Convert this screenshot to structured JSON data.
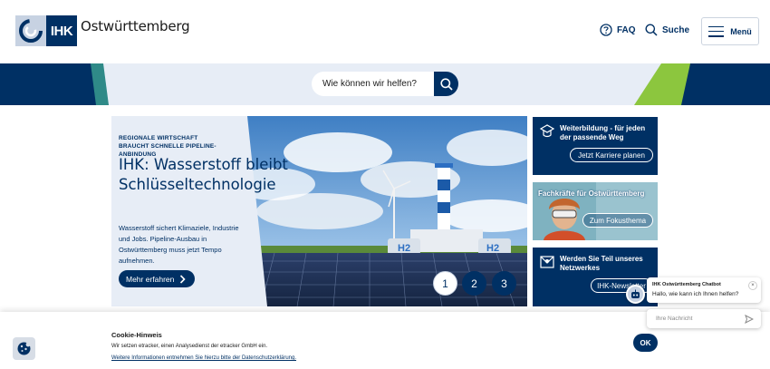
{
  "header": {
    "logo_abbr": "IHK",
    "logo_region": "Ostwürttemberg",
    "faq_label": "FAQ",
    "search_label": "Suche",
    "menu_label": "Menü"
  },
  "search": {
    "placeholder": "Wie können wir helfen?"
  },
  "hero": {
    "kicker": "REGIONALE WIRTSCHAFT BRAUCHT SCHNELLE PIPELINE-ANBINDUNG",
    "title": "IHK: Wasserstoff bleibt Schlüsseltechnologie",
    "description": "Wasserstoff sichert Klimaziele, Industrie und Jobs. Pipeline-Ausbau in Ostwürttemberg muss jetzt Tempo aufnehmen.",
    "button_label": "Mehr erfahren",
    "tank_label": "H2",
    "slides": [
      "1",
      "2",
      "3"
    ]
  },
  "cards": [
    {
      "title": "Weiterbildung - für jeden der passende Weg",
      "button": "Jetzt Karriere planen"
    },
    {
      "title": "Fachkräfte für Ostwürttemberg",
      "button": "Zum Fokusthema"
    },
    {
      "title": "Werden Sie Teil unseres Netzwerkes",
      "button": "IHK-Newsletter"
    }
  ],
  "cookie": {
    "title": "Cookie-Hinweis",
    "text": "Wir setzen etracker, einen Analysedienst der etracker GmbH ein.",
    "link": "Weitere Informationen entnehmen Sie hierzu bitte der Datenschutzerklärung.",
    "ok_label": "OK"
  },
  "chatbot": {
    "name": "IHK Ostwürttemberg Chatbot",
    "message": "Hallo, wie kann ich Ihnen helfen?",
    "input_placeholder": "Ihre Nachricht",
    "close_glyph": "×"
  },
  "colors": {
    "primary": "#003064",
    "band": "#e7edf6",
    "accent_green": "#8cc63e",
    "accent_teal": "#2f8a88"
  }
}
